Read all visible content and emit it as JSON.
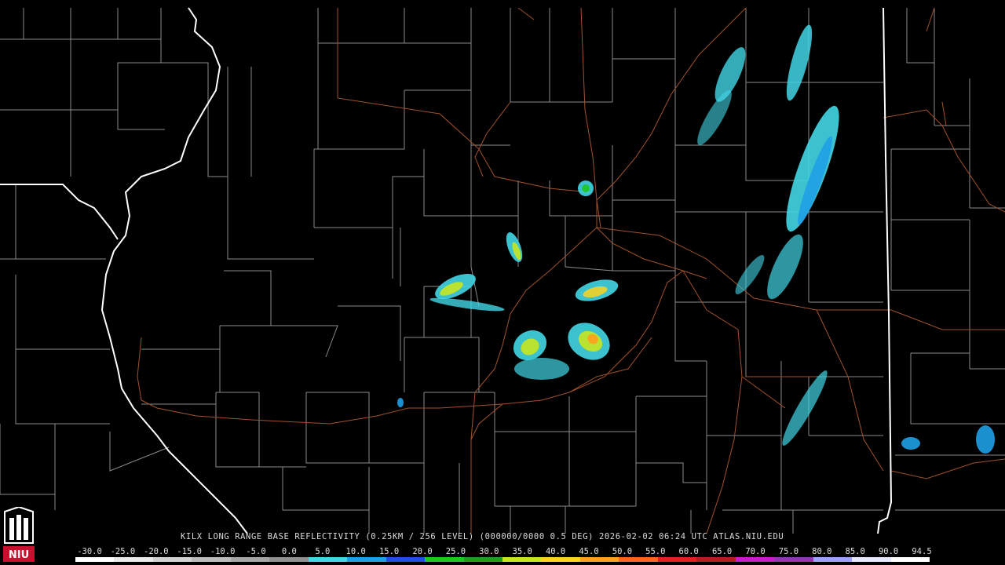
{
  "caption": "KILX LONG RANGE BASE REFLECTIVITY (0.25KM / 256 LEVEL) (000000/0000 0.5 DEG) 2026-02-02 06:24 UTC  ATLAS.NIU.EDU",
  "logo_text": "NIU",
  "scale": {
    "labels": [
      "-30.0",
      "-25.0",
      "-20.0",
      "-15.0",
      "-10.0",
      "-5.0",
      "0.0",
      "5.0",
      "10.0",
      "15.0",
      "20.0",
      "25.0",
      "30.0",
      "35.0",
      "40.0",
      "45.0",
      "50.0",
      "55.0",
      "60.0",
      "65.0",
      "70.0",
      "75.0",
      "80.0",
      "85.0",
      "90.0",
      "94.5"
    ],
    "colors": [
      "#ffffff",
      "#e9e9e9",
      "#d2d2d2",
      "#bcbcbc",
      "#a5a5a5",
      "#8f8f8f",
      "#42d6e6",
      "#1ea0e6",
      "#1e50e6",
      "#1ec81e",
      "#1ea01e",
      "#c8e61e",
      "#ffd21e",
      "#ffa01e",
      "#ff641e",
      "#e61e1e",
      "#b41e1e",
      "#c81ec8",
      "#9632b4",
      "#a0a0ff",
      "#e6e6ff",
      "#ffffff"
    ]
  },
  "colors": {
    "background": "#000000",
    "county_lines": "#8a8a8a",
    "state_lines": "#ffffff",
    "roads": "#a0522d"
  }
}
